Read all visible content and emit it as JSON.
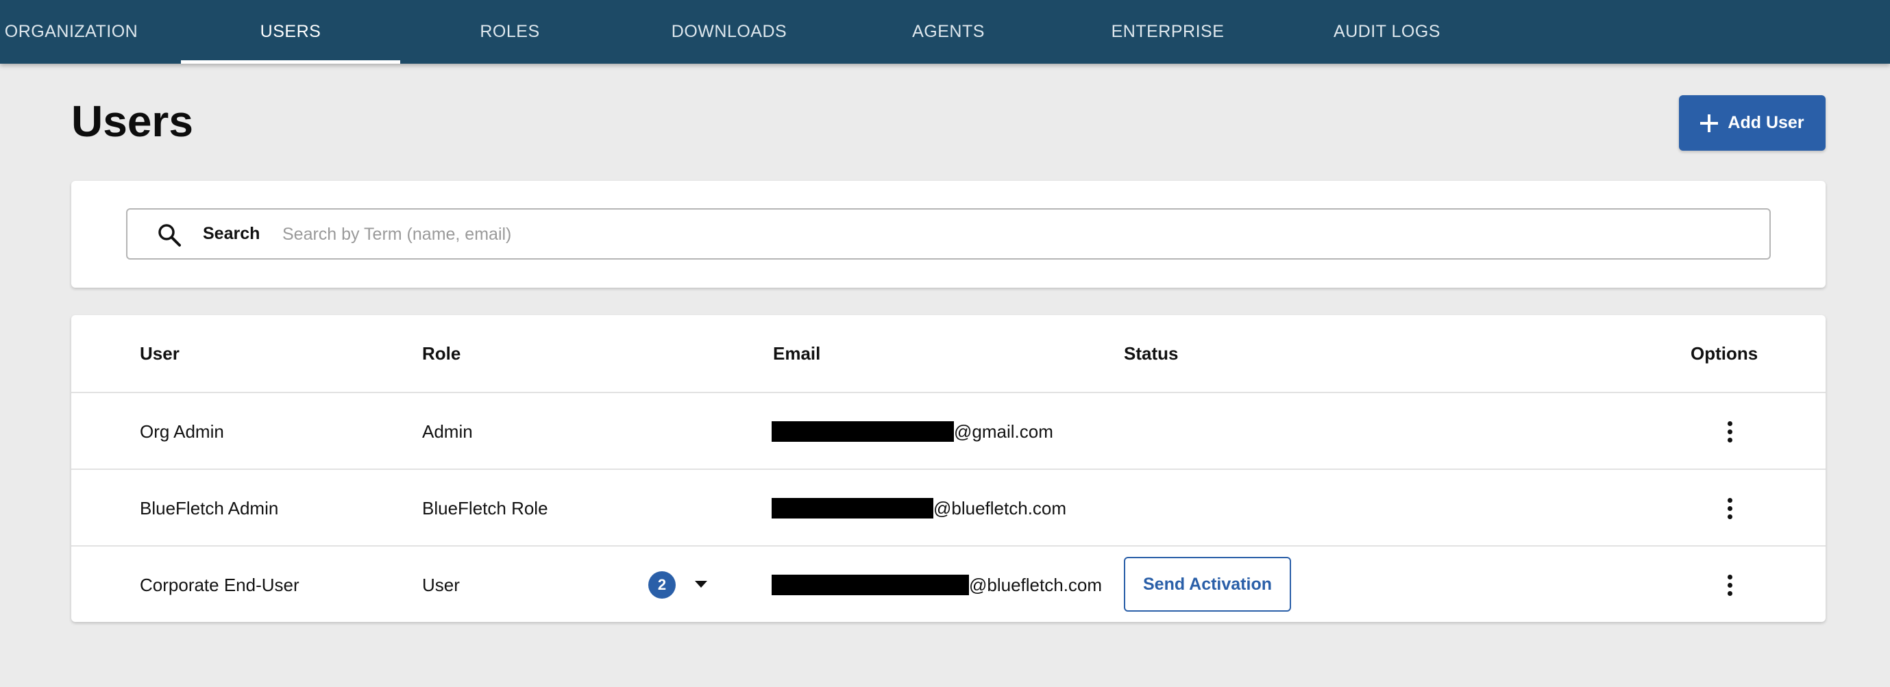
{
  "nav": {
    "items": [
      {
        "label": "ORGANIZATION"
      },
      {
        "label": "USERS",
        "active": true
      },
      {
        "label": "ROLES"
      },
      {
        "label": "DOWNLOADS"
      },
      {
        "label": "AGENTS"
      },
      {
        "label": "ENTERPRISE"
      },
      {
        "label": "AUDIT LOGS"
      }
    ]
  },
  "page": {
    "title": "Users",
    "add_button_label": "Add User"
  },
  "search": {
    "label": "Search",
    "placeholder": "Search by Term (name, email)",
    "value": ""
  },
  "table": {
    "headers": {
      "user": "User",
      "role": "Role",
      "email": "Email",
      "status": "Status",
      "options": "Options"
    },
    "rows": [
      {
        "user": "Org Admin",
        "role": "Admin",
        "email_domain": "@gmail.com",
        "status": ""
      },
      {
        "user": "BlueFletch Admin",
        "role": "BlueFletch Role",
        "email_domain": "@bluefletch.com",
        "status": ""
      },
      {
        "user": "Corporate End-User",
        "role": "User",
        "role_count": "2",
        "email_domain": "@bluefletch.com",
        "status_action": "Send Activation"
      }
    ]
  },
  "colors": {
    "nav_bg": "#1d4a66",
    "accent": "#2a5fa8",
    "page_bg": "#ebebeb"
  }
}
